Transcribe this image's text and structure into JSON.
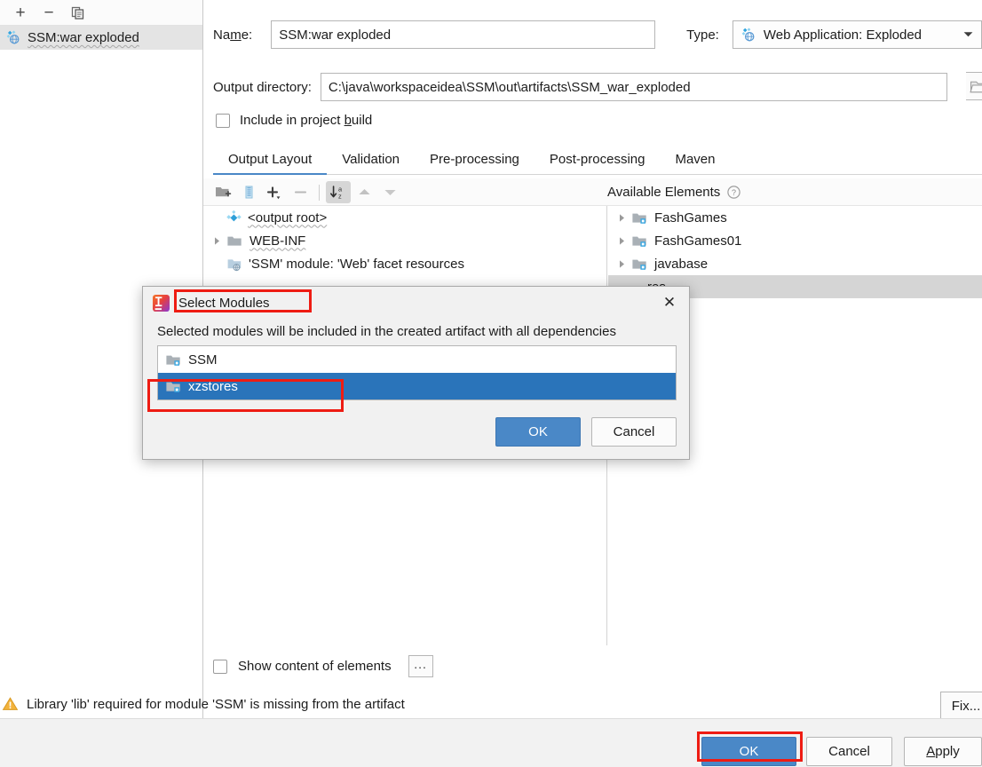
{
  "sidebar": {
    "toolbar": [
      {
        "name": "add-artifact-button",
        "glyph": "+"
      },
      {
        "name": "remove-artifact-button",
        "glyph": "−"
      },
      {
        "name": "copy-artifact-button",
        "glyph": "copy-icon"
      }
    ],
    "artifacts": [
      {
        "label": "SSM:war exploded",
        "icon": "web-application-exploded-icon",
        "selected": true
      }
    ]
  },
  "form": {
    "name_label": "Name:",
    "name_value": "SSM:war exploded",
    "type_label": "Type:",
    "type_value": "Web Application: Exploded",
    "type_icon": "web-application-exploded-icon",
    "output_label": "Output directory:",
    "output_value": "C:\\java\\workspaceidea\\SSM\\out\\artifacts\\SSM_war_exploded",
    "browse_icon": "folder-browse-icon",
    "include_in_build_label": "Include in project build",
    "include_in_build_checked": false
  },
  "tabs": [
    {
      "label": "Output Layout",
      "active": true
    },
    {
      "label": "Validation",
      "active": false
    },
    {
      "label": "Pre-processing",
      "active": false
    },
    {
      "label": "Post-processing",
      "active": false
    },
    {
      "label": "Maven",
      "active": false
    }
  ],
  "elements_toolbar": [
    {
      "name": "create-directory-icon",
      "enabled": true,
      "toggled": false
    },
    {
      "name": "create-archive-icon",
      "enabled": true,
      "toggled": false
    },
    {
      "name": "add-copy-of-icon",
      "enabled": true,
      "toggled": false
    },
    {
      "name": "remove-element-icon",
      "enabled": false,
      "toggled": false
    },
    {
      "name": "sort-alphabetically-icon",
      "enabled": true,
      "toggled": true
    },
    {
      "name": "move-up-icon",
      "enabled": false,
      "toggled": false
    },
    {
      "name": "move-down-icon",
      "enabled": false,
      "toggled": false
    }
  ],
  "available_elements": {
    "header": "Available Elements",
    "help_icon": "help-circle-icon",
    "items": [
      {
        "label": "FashGames",
        "icon": "module-icon",
        "expandable": true
      },
      {
        "label": "FashGames01",
        "icon": "module-icon",
        "expandable": true
      },
      {
        "label": "javabase",
        "icon": "module-icon",
        "expandable": true
      },
      {
        "label": "res",
        "icon": "module-icon",
        "expandable": true,
        "highlighted": true,
        "occluded": true
      }
    ]
  },
  "output_layout_tree": [
    {
      "label": "<output root>",
      "icon": "artifact-root-icon",
      "expandable": false,
      "indent": 0
    },
    {
      "label": "WEB-INF",
      "icon": "folder-icon",
      "expandable": true,
      "indent": 0
    },
    {
      "label": "'SSM' module: 'Web' facet resources",
      "icon": "facet-resources-icon",
      "expandable": false,
      "indent": 1
    }
  ],
  "bottom": {
    "show_content_label": "Show content of elements",
    "show_content_checked": false,
    "ellipsis_label": "...",
    "warning_icon": "warning-triangle-icon",
    "warning_text": "Library 'lib' required for module 'SSM' is missing from the artifact",
    "fix_label": "Fix...",
    "ok_label": "OK",
    "cancel_label": "Cancel",
    "apply_label": "Apply"
  },
  "modal": {
    "app_icon": "intellij-idea-icon",
    "title": "Select Modules",
    "close_icon": "close-icon",
    "description": "Selected modules will be included in the created artifact with all dependencies",
    "modules": [
      {
        "label": "SSM",
        "icon": "module-icon",
        "selected": false
      },
      {
        "label": "xzstores",
        "icon": "module-icon",
        "selected": true
      }
    ],
    "ok_label": "OK",
    "cancel_label": "Cancel"
  },
  "annotations": {
    "accent_color": "#ee1c13",
    "boxes": [
      {
        "name": "annotation-select-modules-title"
      },
      {
        "name": "annotation-xzstores-row"
      },
      {
        "name": "annotation-ok-button"
      }
    ]
  }
}
